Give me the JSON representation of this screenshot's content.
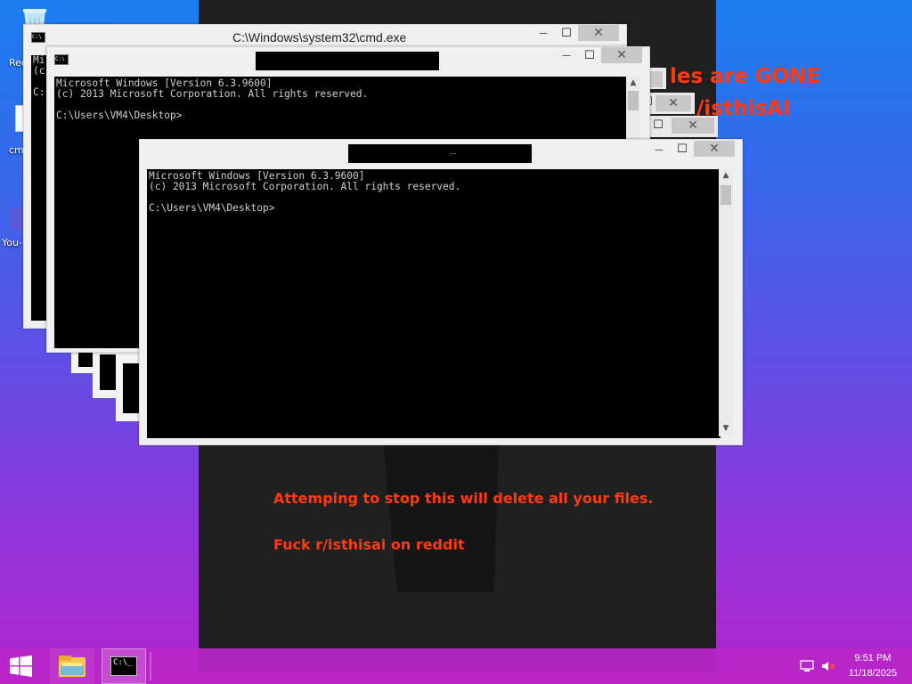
{
  "desktop": {
    "icons": [
      {
        "label": "Red"
      },
      {
        "label": "cm"
      },
      {
        "label": "You-"
      }
    ]
  },
  "ransom": {
    "line1": "les are GONE",
    "line2": "/isthisAI",
    "warning": "Attemping to stop this will delete all your files.",
    "signature": "Fuck r/isthisai on reddit"
  },
  "windows": {
    "back": {
      "title": "C:\\Windows\\system32\\cmd.exe",
      "console_partial": "Mi\n(c\n\nC:"
    },
    "middle": {
      "console": "Microsoft Windows [Version 6.3.9600]\n(c) 2013 Microsoft Corporation. All rights reserved.\n\nC:\\Users\\VM4\\Desktop>"
    },
    "front": {
      "title_visible": "...",
      "console": "Microsoft Windows [Version 6.3.9600]\n(c) 2013 Microsoft Corporation. All rights reserved.\n\nC:\\Users\\VM4\\Desktop>"
    },
    "controls": {
      "minimize": "—",
      "maximize": "☐",
      "close": "✕"
    }
  },
  "taskbar": {
    "cmd_icon_text": "C:\\_",
    "time": "9:51 PM",
    "date": "11/18/2025"
  },
  "icons": {
    "start": "windows-logo-icon",
    "explorer": "file-explorer-icon",
    "cmd": "command-prompt-icon",
    "network": "network-icon",
    "volume": "volume-muted-icon"
  },
  "colors": {
    "ransom_text": "#ff3a0f",
    "taskbar": "#b926c8",
    "console_bg": "#000000"
  }
}
